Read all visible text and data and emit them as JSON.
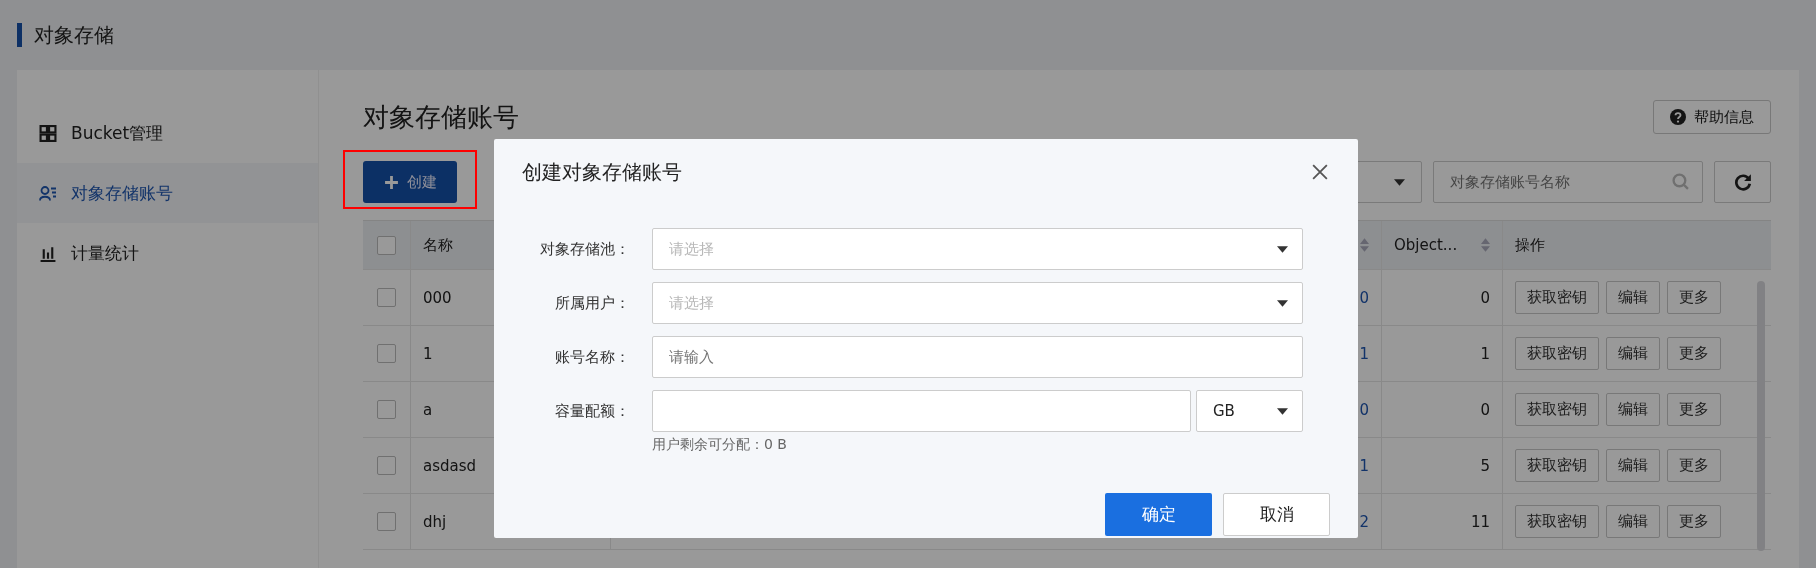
{
  "app_title": "对象存储",
  "sidebar": {
    "items": [
      {
        "kind": "grid",
        "label": "Bucket管理",
        "selected": false
      },
      {
        "kind": "user-list",
        "label": "对象存储账号",
        "selected": true
      },
      {
        "kind": "bar-chart",
        "label": "计量统计",
        "selected": false
      }
    ]
  },
  "page": {
    "title": "对象存储账号",
    "help_button": "帮助信息",
    "create_button": "创建",
    "create_highlighted": true,
    "search": {
      "placeholder": "对象存储账号名称"
    },
    "table": {
      "header_checked": false,
      "columns": [
        {
          "label": "名称",
          "sortable": false
        },
        {
          "sortable": true
        },
        {
          "label": "Object...",
          "sortable": true
        },
        {
          "label": "操作",
          "sortable": false
        }
      ],
      "rows": [
        {
          "checked": false,
          "name": "000",
          "column_3": "0",
          "objects": "0",
          "actions": [
            "获取密钥",
            "编辑",
            "更多"
          ]
        },
        {
          "checked": false,
          "name": "1",
          "column_3": "1",
          "objects": "1",
          "actions": [
            "获取密钥",
            "编辑",
            "更多"
          ]
        },
        {
          "checked": false,
          "name": "a",
          "column_3": "0",
          "objects": "0",
          "actions": [
            "获取密钥",
            "编辑",
            "更多"
          ]
        },
        {
          "checked": false,
          "name": "asdasd",
          "column_3": "1",
          "objects": "5",
          "actions": [
            "获取密钥",
            "编辑",
            "更多"
          ]
        },
        {
          "checked": false,
          "name": "dhj",
          "column_3": "2",
          "objects": "11",
          "actions": [
            "获取密钥",
            "编辑",
            "更多"
          ]
        }
      ]
    }
  },
  "dialog": {
    "title": "创建对象存储账号",
    "fields": [
      {
        "kind": "select",
        "label": "对象存储池：",
        "placeholder": "请选择"
      },
      {
        "kind": "select",
        "label": "所属用户：",
        "placeholder": "请选择"
      },
      {
        "kind": "input",
        "label": "账号名称：",
        "placeholder": "请输入"
      },
      {
        "kind": "quota",
        "label": "容量配额：",
        "unit": "GB",
        "hint": "用户剩余可分配：0 B"
      }
    ],
    "buttons": [
      {
        "kind": "primary",
        "label": "确定"
      },
      {
        "kind": "default",
        "label": "取消"
      }
    ]
  }
}
